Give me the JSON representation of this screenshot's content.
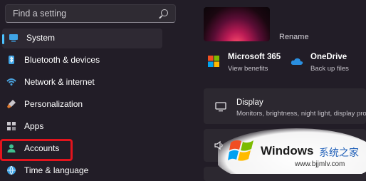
{
  "search": {
    "placeholder": "Find a setting"
  },
  "nav": [
    {
      "label": "System",
      "icon": "system-icon",
      "active": true
    },
    {
      "label": "Bluetooth & devices",
      "icon": "bluetooth-icon"
    },
    {
      "label": "Network & internet",
      "icon": "wifi-icon"
    },
    {
      "label": "Personalization",
      "icon": "brush-icon"
    },
    {
      "label": "Apps",
      "icon": "apps-icon"
    },
    {
      "label": "Accounts",
      "icon": "account-icon",
      "highlighted": true
    },
    {
      "label": "Time & language",
      "icon": "globe-icon"
    }
  ],
  "device": {
    "rename_label": "Rename"
  },
  "tiles": [
    {
      "title": "Microsoft 365",
      "subtitle": "View benefits",
      "icon": "microsoft-365-icon"
    },
    {
      "title": "OneDrive",
      "subtitle": "Back up files",
      "icon": "onedrive-icon"
    }
  ],
  "cards": [
    {
      "title": "Display",
      "subtitle": "Monitors, brightness, night light, display profile",
      "icon": "display-icon"
    }
  ],
  "watermark": {
    "brand": "Windows",
    "suffix": "系统之家",
    "url": "www.bjjmlv.com"
  },
  "colors": {
    "accent": "#4cc2ff",
    "highlight": "#e3141d",
    "background": "#221d27"
  }
}
